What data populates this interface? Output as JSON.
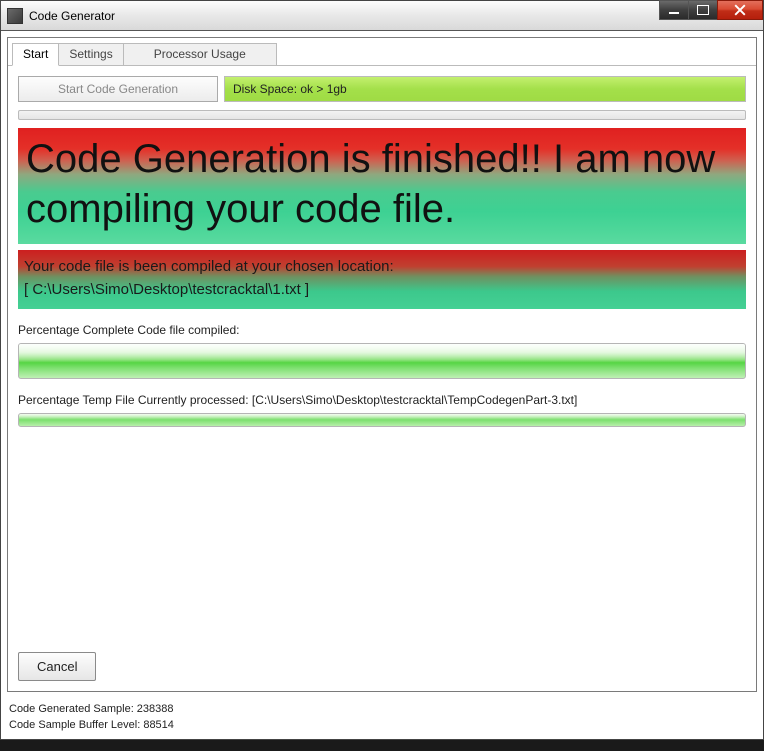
{
  "window": {
    "title": "Code Generator"
  },
  "tabs": {
    "start": "Start",
    "settings": "Settings",
    "processor": "Processor Usage"
  },
  "toolbar": {
    "start_button": "Start Code Generation",
    "disk_space": "Disk Space: ok > 1gb"
  },
  "banner": {
    "main": "Code Generation is finished!! I am now compiling your code file.",
    "sub_line1": "Your code file is been compiled at your chosen location:",
    "sub_line2": "[ C:\\Users\\Simo\\Desktop\\testcracktal\\1.txt ]"
  },
  "progress": {
    "compiled_label": "Percentage Complete Code file compiled:",
    "temp_label": "Percentage Temp File Currently processed: [C:\\Users\\Simo\\Desktop\\testcracktal\\TempCodegenPart-3.txt]"
  },
  "buttons": {
    "cancel": "Cancel"
  },
  "status": {
    "line1": "Code Generated Sample: 238388",
    "line2": "Code Sample Buffer Level: 88514"
  }
}
